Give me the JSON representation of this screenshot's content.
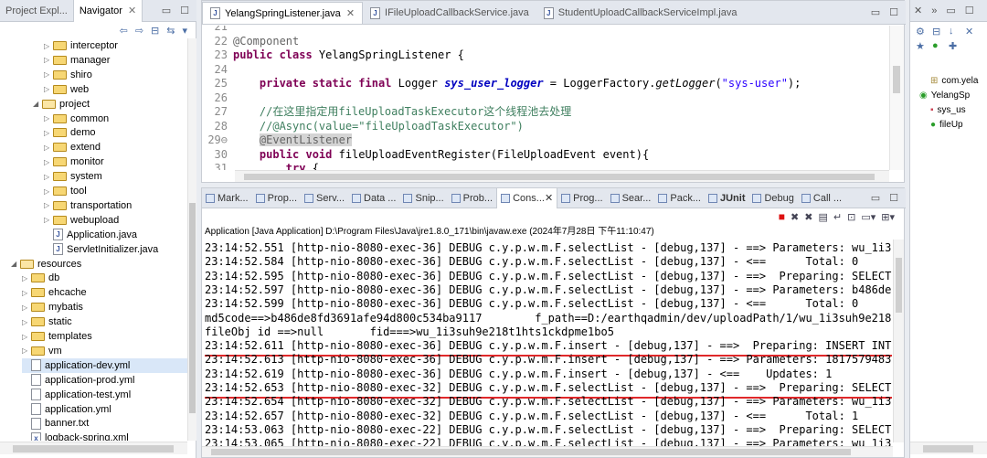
{
  "navigator": {
    "tabs": [
      "Project Expl...",
      "Navigator"
    ],
    "tree": [
      {
        "label": "interceptor",
        "depth": 3,
        "kind": "folder"
      },
      {
        "label": "manager",
        "depth": 3,
        "kind": "folder"
      },
      {
        "label": "shiro",
        "depth": 3,
        "kind": "folder"
      },
      {
        "label": "web",
        "depth": 3,
        "kind": "folder"
      },
      {
        "label": "project",
        "depth": 2,
        "kind": "folder-open"
      },
      {
        "label": "common",
        "depth": 3,
        "kind": "folder"
      },
      {
        "label": "demo",
        "depth": 3,
        "kind": "folder"
      },
      {
        "label": "extend",
        "depth": 3,
        "kind": "folder"
      },
      {
        "label": "monitor",
        "depth": 3,
        "kind": "folder"
      },
      {
        "label": "system",
        "depth": 3,
        "kind": "folder"
      },
      {
        "label": "tool",
        "depth": 3,
        "kind": "folder"
      },
      {
        "label": "transportation",
        "depth": 3,
        "kind": "folder"
      },
      {
        "label": "webupload",
        "depth": 3,
        "kind": "folder"
      },
      {
        "label": "Application.java",
        "depth": 3,
        "kind": "java"
      },
      {
        "label": "ServletInitializer.java",
        "depth": 3,
        "kind": "java"
      },
      {
        "label": "resources",
        "depth": 0,
        "kind": "folder-open"
      },
      {
        "label": "db",
        "depth": 1,
        "kind": "folder"
      },
      {
        "label": "ehcache",
        "depth": 1,
        "kind": "folder"
      },
      {
        "label": "mybatis",
        "depth": 1,
        "kind": "folder"
      },
      {
        "label": "static",
        "depth": 1,
        "kind": "folder"
      },
      {
        "label": "templates",
        "depth": 1,
        "kind": "folder"
      },
      {
        "label": "vm",
        "depth": 1,
        "kind": "folder"
      },
      {
        "label": "application-dev.yml",
        "depth": 1,
        "kind": "file",
        "selected": true
      },
      {
        "label": "application-prod.yml",
        "depth": 1,
        "kind": "file"
      },
      {
        "label": "application-test.yml",
        "depth": 1,
        "kind": "file"
      },
      {
        "label": "application.yml",
        "depth": 1,
        "kind": "file"
      },
      {
        "label": "banner.txt",
        "depth": 1,
        "kind": "file"
      },
      {
        "label": "logback-spring.xml",
        "depth": 1,
        "kind": "xml"
      }
    ]
  },
  "editor": {
    "tabs": [
      {
        "label": "YelangSpringListener.java",
        "active": true
      },
      {
        "label": "IFileUploadCallbackService.java",
        "active": false
      },
      {
        "label": "StudentUploadCallbackServiceImpl.java",
        "active": false
      }
    ],
    "lines": [
      {
        "num": "21",
        "segments": [
          {
            "t": "",
            "c": ""
          }
        ]
      },
      {
        "num": "22",
        "segments": [
          {
            "t": "@Component",
            "c": "an"
          }
        ]
      },
      {
        "num": "23",
        "segments": [
          {
            "t": "public class ",
            "c": "kw"
          },
          {
            "t": "YelangSpringListener {",
            "c": ""
          }
        ]
      },
      {
        "num": "24",
        "segments": [
          {
            "t": "",
            "c": ""
          }
        ]
      },
      {
        "num": "25",
        "segments": [
          {
            "t": "    ",
            "c": ""
          },
          {
            "t": "private static final ",
            "c": "kw"
          },
          {
            "t": "Logger ",
            "c": ""
          },
          {
            "t": "sys_user_logger",
            "c": "it"
          },
          {
            "t": " = LoggerFactory.",
            "c": ""
          },
          {
            "t": "getLogger",
            "c": "mi"
          },
          {
            "t": "(",
            "c": ""
          },
          {
            "t": "\"sys-user\"",
            "c": "str"
          },
          {
            "t": ");",
            "c": ""
          }
        ]
      },
      {
        "num": "26",
        "segments": [
          {
            "t": "",
            "c": ""
          }
        ]
      },
      {
        "num": "27",
        "segments": [
          {
            "t": "    //在这里指定用fileUploadTaskExecutor这个线程池去处理",
            "c": "cm"
          }
        ]
      },
      {
        "num": "28",
        "segments": [
          {
            "t": "    //@Async(value=\"fileUploadTaskExecutor\")",
            "c": "cm"
          }
        ]
      },
      {
        "num": "29⊖",
        "segments": [
          {
            "t": "    ",
            "c": ""
          },
          {
            "t": "@EventListener",
            "c": "an hl"
          }
        ]
      },
      {
        "num": "30",
        "segments": [
          {
            "t": "    ",
            "c": ""
          },
          {
            "t": "public void ",
            "c": "kw"
          },
          {
            "t": "fileUploadEventRegister(FileUploadEvent event){",
            "c": ""
          }
        ]
      },
      {
        "num": "31",
        "segments": [
          {
            "t": "        ",
            "c": ""
          },
          {
            "t": "try",
            "c": "kw"
          },
          {
            "t": " {",
            "c": ""
          }
        ]
      }
    ]
  },
  "console": {
    "tabs": [
      "Mark...",
      "Prop...",
      "Serv...",
      "Data ...",
      "Snip...",
      "Prob...",
      "Cons...",
      "Prog...",
      "Sear...",
      "Pack...",
      "JUnit",
      "Debug",
      "Call ..."
    ],
    "active_tab": "Cons...",
    "launch_label": "Application [Java Application] D:\\Program Files\\Java\\jre1.8.0_171\\bin\\javaw.exe (2024年7月28日 下午11:10:47)",
    "lines": [
      "23:14:52.551 [http-nio-8080-exec-36] DEBUG c.y.p.w.m.F.selectList - [debug,137] - ==> Parameters: wu_1i3s",
      "23:14:52.584 [http-nio-8080-exec-36] DEBUG c.y.p.w.m.F.selectList - [debug,137] - <==      Total: 0",
      "23:14:52.595 [http-nio-8080-exec-36] DEBUG c.y.p.w.m.F.selectList - [debug,137] - ==>  Preparing: SELECT",
      "23:14:52.597 [http-nio-8080-exec-36] DEBUG c.y.p.w.m.F.selectList - [debug,137] - ==> Parameters: b486de8",
      "23:14:52.599 [http-nio-8080-exec-36] DEBUG c.y.p.w.m.F.selectList - [debug,137] - <==      Total: 0",
      "md5code==>b486de8fd3691afe94d800c534ba9117        f_path==D:/earthqadmin/dev/uploadPath/1/wu_1i3suh9e218t1",
      "fileObj id ==>null       fid===>wu_1i3suh9e218t1hts1ckdpme1bo5",
      "23:14:52.611 [http-nio-8080-exec-36] DEBUG c.y.p.w.m.F.insert - [debug,137] - ==>  Preparing: INSERT INTO",
      "23:14:52.613 [http-nio-8080-exec-36] DEBUG c.y.p.w.m.F.insert - [debug,137] - ==> Parameters: 18175794838",
      "23:14:52.619 [http-nio-8080-exec-36] DEBUG c.y.p.w.m.F.insert - [debug,137] - <==    Updates: 1",
      "23:14:52.653 [http-nio-8080-exec-32] DEBUG c.y.p.w.m.F.selectList - [debug,137] - ==>  Preparing: SELECT",
      "23:14:52.654 [http-nio-8080-exec-32] DEBUG c.y.p.w.m.F.selectList - [debug,137] - ==> Parameters: wu_1i3s",
      "23:14:52.657 [http-nio-8080-exec-32] DEBUG c.y.p.w.m.F.selectList - [debug,137] - <==      Total: 1",
      "23:14:53.063 [http-nio-8080-exec-22] DEBUG c.y.p.w.m.F.selectList - [debug,137] - ==>  Preparing: SELECT",
      "23:14:53.065 [http-nio-8080-exec-22] DEBUG c.y.p.w.m.F.selectList - [debug,137] - ==> Parameters: wu_1i3s"
    ]
  },
  "outline": {
    "items": [
      "com.yela",
      "YelangSp",
      "sys_us",
      "fileUp"
    ]
  }
}
